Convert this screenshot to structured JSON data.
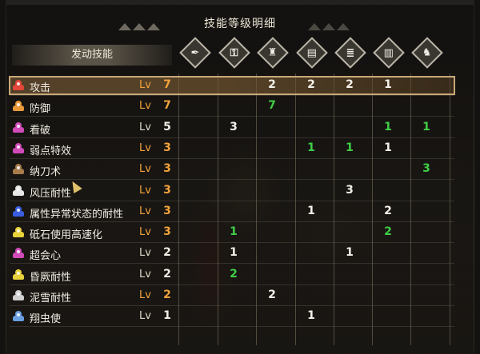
{
  "title": "技能等级明细",
  "header": {
    "active_skills_label": "发动技能"
  },
  "equipment_slots": [
    {
      "name": "weapon-slot",
      "icon": "greatsword-icon",
      "glyph": "✒"
    },
    {
      "name": "talisman-slot",
      "icon": "talisman-icon",
      "glyph": "⚿"
    },
    {
      "name": "helm-slot",
      "icon": "helm-icon",
      "glyph": "♜"
    },
    {
      "name": "chest-slot",
      "icon": "chest-armor-icon",
      "glyph": "▤"
    },
    {
      "name": "arms-slot",
      "icon": "arm-armor-icon",
      "glyph": "≣"
    },
    {
      "name": "waist-slot",
      "icon": "waist-armor-icon",
      "glyph": "▥"
    },
    {
      "name": "legs-slot",
      "icon": "leg-armor-icon",
      "glyph": "♞"
    }
  ],
  "skills": [
    {
      "name": "攻击",
      "lv_label": "Lv",
      "level": "7",
      "maxed": true,
      "color": "#e2473a",
      "cells": [
        "",
        "",
        "2",
        "2",
        "2",
        "1",
        ""
      ],
      "highlight": true
    },
    {
      "name": "防御",
      "lv_label": "Lv",
      "level": "7",
      "maxed": true,
      "color": "#e89a3a",
      "cells": [
        "",
        "",
        "7",
        "",
        "",
        "",
        ""
      ]
    },
    {
      "name": "看破",
      "lv_label": "Lv",
      "level": "5",
      "maxed": false,
      "color": "#d04bb8",
      "cells": [
        "",
        "3",
        "",
        "",
        "",
        "1",
        "1"
      ]
    },
    {
      "name": "弱点特效",
      "lv_label": "Lv",
      "level": "3",
      "maxed": true,
      "color": "#d04bb8",
      "cells": [
        "",
        "",
        "",
        "1",
        "1",
        "1",
        ""
      ]
    },
    {
      "name": "纳刀术",
      "lv_label": "Lv",
      "level": "3",
      "maxed": true,
      "color": "#a87c4a",
      "cells": [
        "",
        "",
        "",
        "",
        "",
        "",
        "3"
      ]
    },
    {
      "name": "风压耐性",
      "lv_label": "Lv",
      "level": "3",
      "maxed": true,
      "color": "#e8e8e8",
      "cells": [
        "",
        "",
        "",
        "",
        "3",
        "",
        ""
      ]
    },
    {
      "name": "属性异常状态的耐性",
      "lv_label": "Lv",
      "level": "3",
      "maxed": true,
      "color": "#3a5ee0",
      "cells": [
        "",
        "",
        "",
        "1",
        "",
        "2",
        ""
      ]
    },
    {
      "name": "砥石使用高速化",
      "lv_label": "Lv",
      "level": "3",
      "maxed": true,
      "color": "#e8d23a",
      "cells": [
        "",
        "1",
        "",
        "",
        "",
        "2",
        ""
      ]
    },
    {
      "name": "超会心",
      "lv_label": "Lv",
      "level": "2",
      "maxed": false,
      "color": "#d04bb8",
      "cells": [
        "",
        "1",
        "",
        "",
        "1",
        "",
        ""
      ]
    },
    {
      "name": "昏厥耐性",
      "lv_label": "Lv",
      "level": "2",
      "maxed": false,
      "color": "#e8d23a",
      "cells": [
        "",
        "2",
        "",
        "",
        "",
        "",
        ""
      ]
    },
    {
      "name": "泥雪耐性",
      "lv_label": "Lv",
      "level": "2",
      "maxed": true,
      "color": "#cfcfcf",
      "cells": [
        "",
        "",
        "2",
        "",
        "",
        "",
        ""
      ]
    },
    {
      "name": "翔虫使",
      "lv_label": "Lv",
      "level": "1",
      "maxed": false,
      "color": "#6a9fe0",
      "cells": [
        "",
        "",
        "",
        "1",
        "",
        "",
        ""
      ]
    }
  ],
  "cell_colors": [
    [
      "",
      "",
      "white",
      "white",
      "white",
      "white",
      ""
    ],
    [
      "",
      "",
      "green",
      "",
      "",
      "",
      ""
    ],
    [
      "",
      "white",
      "",
      "",
      "",
      "green",
      "green"
    ],
    [
      "",
      "",
      "",
      "green",
      "green",
      "white",
      ""
    ],
    [
      "",
      "",
      "",
      "",
      "",
      "",
      "green"
    ],
    [
      "",
      "",
      "",
      "",
      "white",
      "",
      ""
    ],
    [
      "",
      "",
      "",
      "white",
      "",
      "white",
      ""
    ],
    [
      "",
      "green",
      "",
      "",
      "",
      "green",
      ""
    ],
    [
      "",
      "white",
      "",
      "",
      "white",
      "",
      ""
    ],
    [
      "",
      "green",
      "",
      "",
      "",
      "",
      ""
    ],
    [
      "",
      "",
      "white",
      "",
      "",
      "",
      ""
    ],
    [
      "",
      "",
      "",
      "white",
      "",
      "",
      ""
    ]
  ],
  "colors": {
    "maxed_level": "#f2a23c",
    "added_points": "#3fcf46",
    "panel_bg": "#141210"
  }
}
